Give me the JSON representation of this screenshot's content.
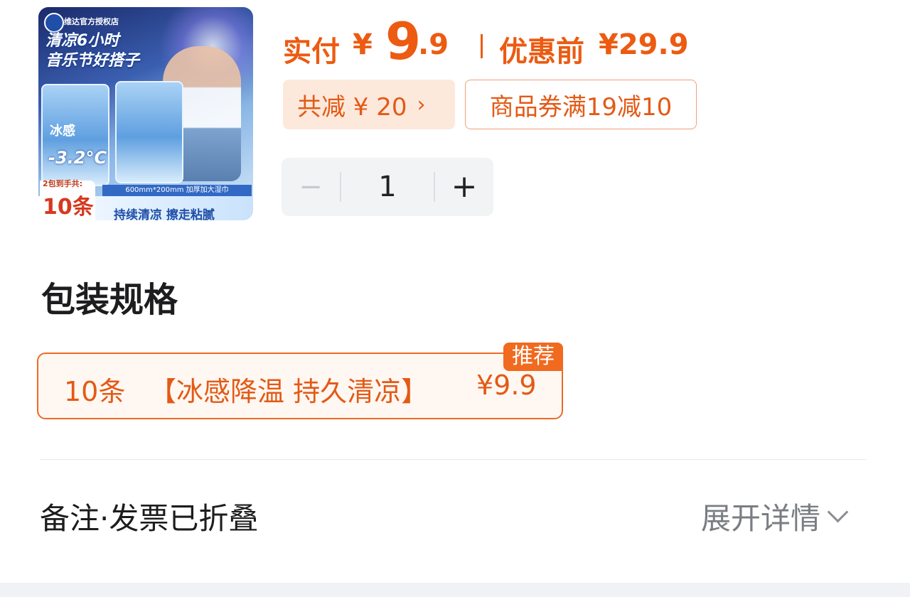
{
  "product_image": {
    "shop_name": "维达官方授权店",
    "headline_line1": "清凉6小时",
    "headline_line2": "音乐节好搭子",
    "pack_title": "冰感",
    "temperature": "-3.2°C",
    "size_text": "600mm*200mm 加厚加大湿巾",
    "count_small": "2包到手共:",
    "count_big": "10条",
    "slogan": "持续清凉 擦走粘腻"
  },
  "price": {
    "label": "实付",
    "currency": "¥",
    "integer": "9",
    "decimal": ".9",
    "original_label": "优惠前",
    "original_value": "¥29.9"
  },
  "discount": {
    "reduce_label": "共减 ¥ 20",
    "reduce_chevron": "›",
    "coupon_label": "商品券满19减10"
  },
  "quantity": {
    "minus": "−",
    "value": "1",
    "plus": "+"
  },
  "spec": {
    "title": "包装规格",
    "options": [
      {
        "count": "10条",
        "desc": "【冰感降温 持久清凉】",
        "price": "¥9.9",
        "tag": "推荐"
      }
    ]
  },
  "footer": {
    "note_label": "备注·发票已折叠",
    "expand_label": "展开详情"
  },
  "colors": {
    "accent": "#ec5b11",
    "chip_bg": "#fde8dc",
    "stepper_bg": "#f2f3f5"
  }
}
